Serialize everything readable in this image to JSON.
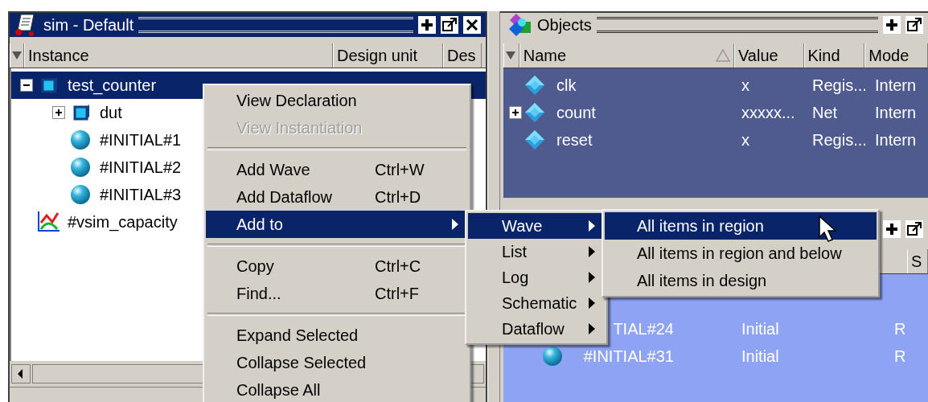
{
  "sim_panel": {
    "title": "sim - Default",
    "columns": [
      "Instance",
      "Design unit",
      "Des"
    ],
    "tree": [
      {
        "name": "test_counter",
        "kind": "module",
        "selected": true,
        "expanded": true,
        "children": [
          {
            "name": "dut",
            "kind": "module",
            "selected": false,
            "expanded": false
          },
          {
            "name": "#INITIAL#1",
            "kind": "process",
            "selected": false
          },
          {
            "name": "#INITIAL#2",
            "kind": "process",
            "selected": false
          },
          {
            "name": "#INITIAL#3",
            "kind": "process",
            "selected": false
          }
        ]
      },
      {
        "name": "#vsim_capacity",
        "kind": "capacity",
        "selected": false
      }
    ]
  },
  "objects_panel": {
    "title": "Objects",
    "columns": [
      "Name",
      "Value",
      "Kind",
      "Mode"
    ],
    "rows": [
      {
        "name": "clk",
        "value": "x",
        "type": "Regis...",
        "mode": "Intern"
      },
      {
        "name": "count",
        "expanded": false,
        "value": "xxxxx...",
        "type": "Net",
        "mode": "Intern"
      },
      {
        "name": "reset",
        "value": "x",
        "type": "Regis...",
        "mode": "Intern"
      }
    ]
  },
  "lower_panel": {
    "columns": [
      "S"
    ],
    "rows": [
      {
        "name": "TIAL#24",
        "type": "Initial",
        "column_3": "R"
      },
      {
        "name": "#INITIAL#31",
        "kind": "process",
        "type": "Initial",
        "column_3": "R"
      }
    ]
  },
  "context_menu": {
    "items": [
      {
        "kind": "item",
        "label": "View Declaration",
        "disabled": false,
        "selected": false
      },
      {
        "kind": "item",
        "label": "View Instantiation",
        "disabled": true,
        "selected": false
      },
      {
        "kind": "separator"
      },
      {
        "kind": "item",
        "label": "Add Wave",
        "shortcut": "Ctrl+W",
        "disabled": false,
        "selected": false
      },
      {
        "kind": "item",
        "label": "Add Dataflow",
        "shortcut": "Ctrl+D",
        "disabled": false,
        "selected": false
      },
      {
        "kind": "submenu",
        "label": "Add to",
        "disabled": false,
        "selected": true
      },
      {
        "kind": "separator"
      },
      {
        "kind": "item",
        "label": "Copy",
        "shortcut": "Ctrl+C",
        "disabled": false,
        "selected": false
      },
      {
        "kind": "item",
        "label": "Find...",
        "shortcut": "Ctrl+F",
        "disabled": false,
        "selected": false
      },
      {
        "kind": "separator"
      },
      {
        "kind": "item",
        "label": "Expand Selected",
        "disabled": false,
        "selected": false
      },
      {
        "kind": "item",
        "label": "Collapse Selected",
        "disabled": false,
        "selected": false
      },
      {
        "kind": "item",
        "label": "Collapse All",
        "disabled": false,
        "selected": false
      }
    ]
  },
  "add_to_menu": {
    "items": [
      {
        "kind": "submenu",
        "label": "Wave",
        "disabled": false,
        "selected": true
      },
      {
        "kind": "submenu",
        "label": "List",
        "disabled": false,
        "selected": false
      },
      {
        "kind": "submenu",
        "label": "Log",
        "disabled": false,
        "selected": false
      },
      {
        "kind": "submenu",
        "label": "Schematic",
        "disabled": false,
        "selected": false
      },
      {
        "kind": "submenu",
        "label": "Dataflow",
        "disabled": false,
        "selected": false
      }
    ]
  },
  "wave_menu": {
    "items": [
      {
        "kind": "item",
        "label": "All items in region",
        "disabled": false,
        "selected": true
      },
      {
        "kind": "item",
        "label": "All items in region and below",
        "disabled": false,
        "selected": false
      },
      {
        "kind": "item",
        "label": "All items in design",
        "disabled": false,
        "selected": false
      }
    ]
  }
}
